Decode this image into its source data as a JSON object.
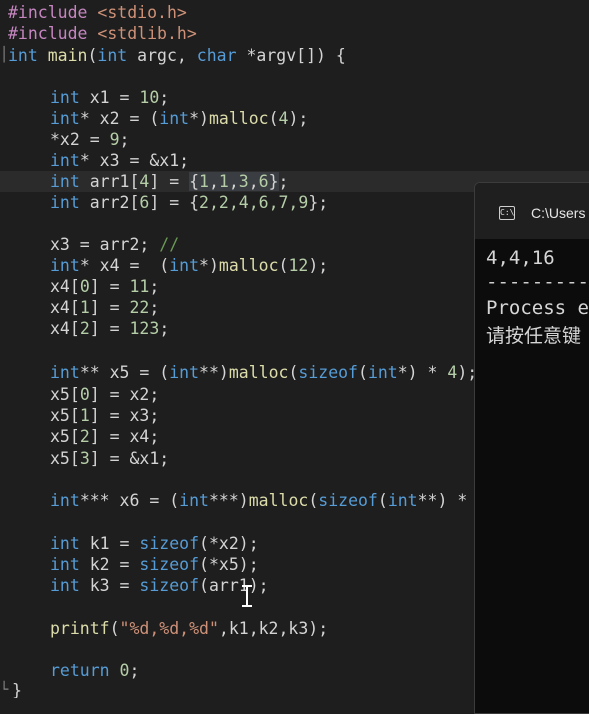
{
  "editor": {
    "lines": {
      "l1": {
        "pp": "#include",
        "rest": " <stdio.h>"
      },
      "l2": {
        "pp": "#include",
        "rest": " <stdlib.h>"
      },
      "l3": {
        "t1": "int",
        "fn": " main",
        "p1": "(",
        "t2": "int",
        "p2": " argc, ",
        "t3": "char",
        "p3": " *argv[]) {"
      },
      "l5": {
        "t": "int",
        "a": " x1 = ",
        "n": "10",
        "b": ";"
      },
      "l6": {
        "t": "int",
        "a": "* x2 = (",
        "t2": "int",
        "b": "*)",
        "fn": "malloc",
        "c": "(",
        "n": "4",
        "d": ");"
      },
      "l7": {
        "a": "*x2 = ",
        "n": "9",
        "b": ";"
      },
      "l8": {
        "t": "int",
        "a": "* x3 = &x1;"
      },
      "l9": {
        "t": "int",
        "a": " arr1[",
        "n": "4",
        "b": "] = ",
        "sel1": "{",
        "n1": "1",
        "c1": ",",
        "n2": "1",
        "c2": ",",
        "n3": "3",
        "c3": ",",
        "n4": "6",
        "sel2": "}",
        "end": ";"
      },
      "l10": {
        "t": "int",
        "a": " arr2[",
        "n": "6",
        "b": "] = {",
        "v": "2,2,4,6,7,9",
        "c": "};"
      },
      "l12": {
        "a": "x3 = arr2; ",
        "cm": "//"
      },
      "l13": {
        "t": "int",
        "a": "* x4 =  (",
        "t2": "int",
        "b": "*)",
        "fn": "malloc",
        "c": "(",
        "n": "12",
        "d": ");"
      },
      "l14": {
        "a": "x4[",
        "i": "0",
        "b": "] = ",
        "n": "11",
        "c": ";"
      },
      "l15": {
        "a": "x4[",
        "i": "1",
        "b": "] = ",
        "n": "22",
        "c": ";"
      },
      "l16": {
        "a": "x4[",
        "i": "2",
        "b": "] = ",
        "n": "123",
        "c": ";"
      },
      "l18": {
        "t": "int",
        "a": "** x5 = (",
        "t2": "int",
        "b": "**)",
        "fn": "malloc",
        "c": "(",
        "so": "sizeof",
        "d": "(",
        "t3": "int",
        "e": "*) * ",
        "n": "4",
        "f": ");"
      },
      "l19": {
        "a": "x5[",
        "i": "0",
        "b": "] = x2;"
      },
      "l20": {
        "a": "x5[",
        "i": "1",
        "b": "] = x3;"
      },
      "l21": {
        "a": "x5[",
        "i": "2",
        "b": "] = x4;"
      },
      "l22": {
        "a": "x5[",
        "i": "3",
        "b": "] = &x1;"
      },
      "l24": {
        "t": "int",
        "a": "*** x6 = (",
        "t2": "int",
        "b": "***)",
        "fn": "malloc",
        "c": "(",
        "so": "sizeof",
        "d": "(",
        "t3": "int",
        "e": "**) *"
      },
      "l26": {
        "t": "int",
        "a": " k1 = ",
        "so": "sizeof",
        "b": "(*x2);"
      },
      "l27": {
        "t": "int",
        "a": " k2 = ",
        "so": "sizeof",
        "b": "(*x5);"
      },
      "l28": {
        "t": "int",
        "a": " k3 = ",
        "so": "sizeof",
        "b": "(arr1);"
      },
      "l30": {
        "fn": "printf",
        "a": "(",
        "s": "\"%d,%d,%d\"",
        "b": ",k1,k2,k3);"
      },
      "l32": {
        "kw": "return",
        "a": " ",
        "n": "0",
        "b": ";"
      },
      "l33": {
        "a": "}"
      }
    }
  },
  "console": {
    "title": "C:\\Users",
    "icon": "C:\\",
    "output_line": "4,4,16",
    "separator": "------------",
    "process_text": "Process e",
    "prompt_text": "请按任意键"
  }
}
